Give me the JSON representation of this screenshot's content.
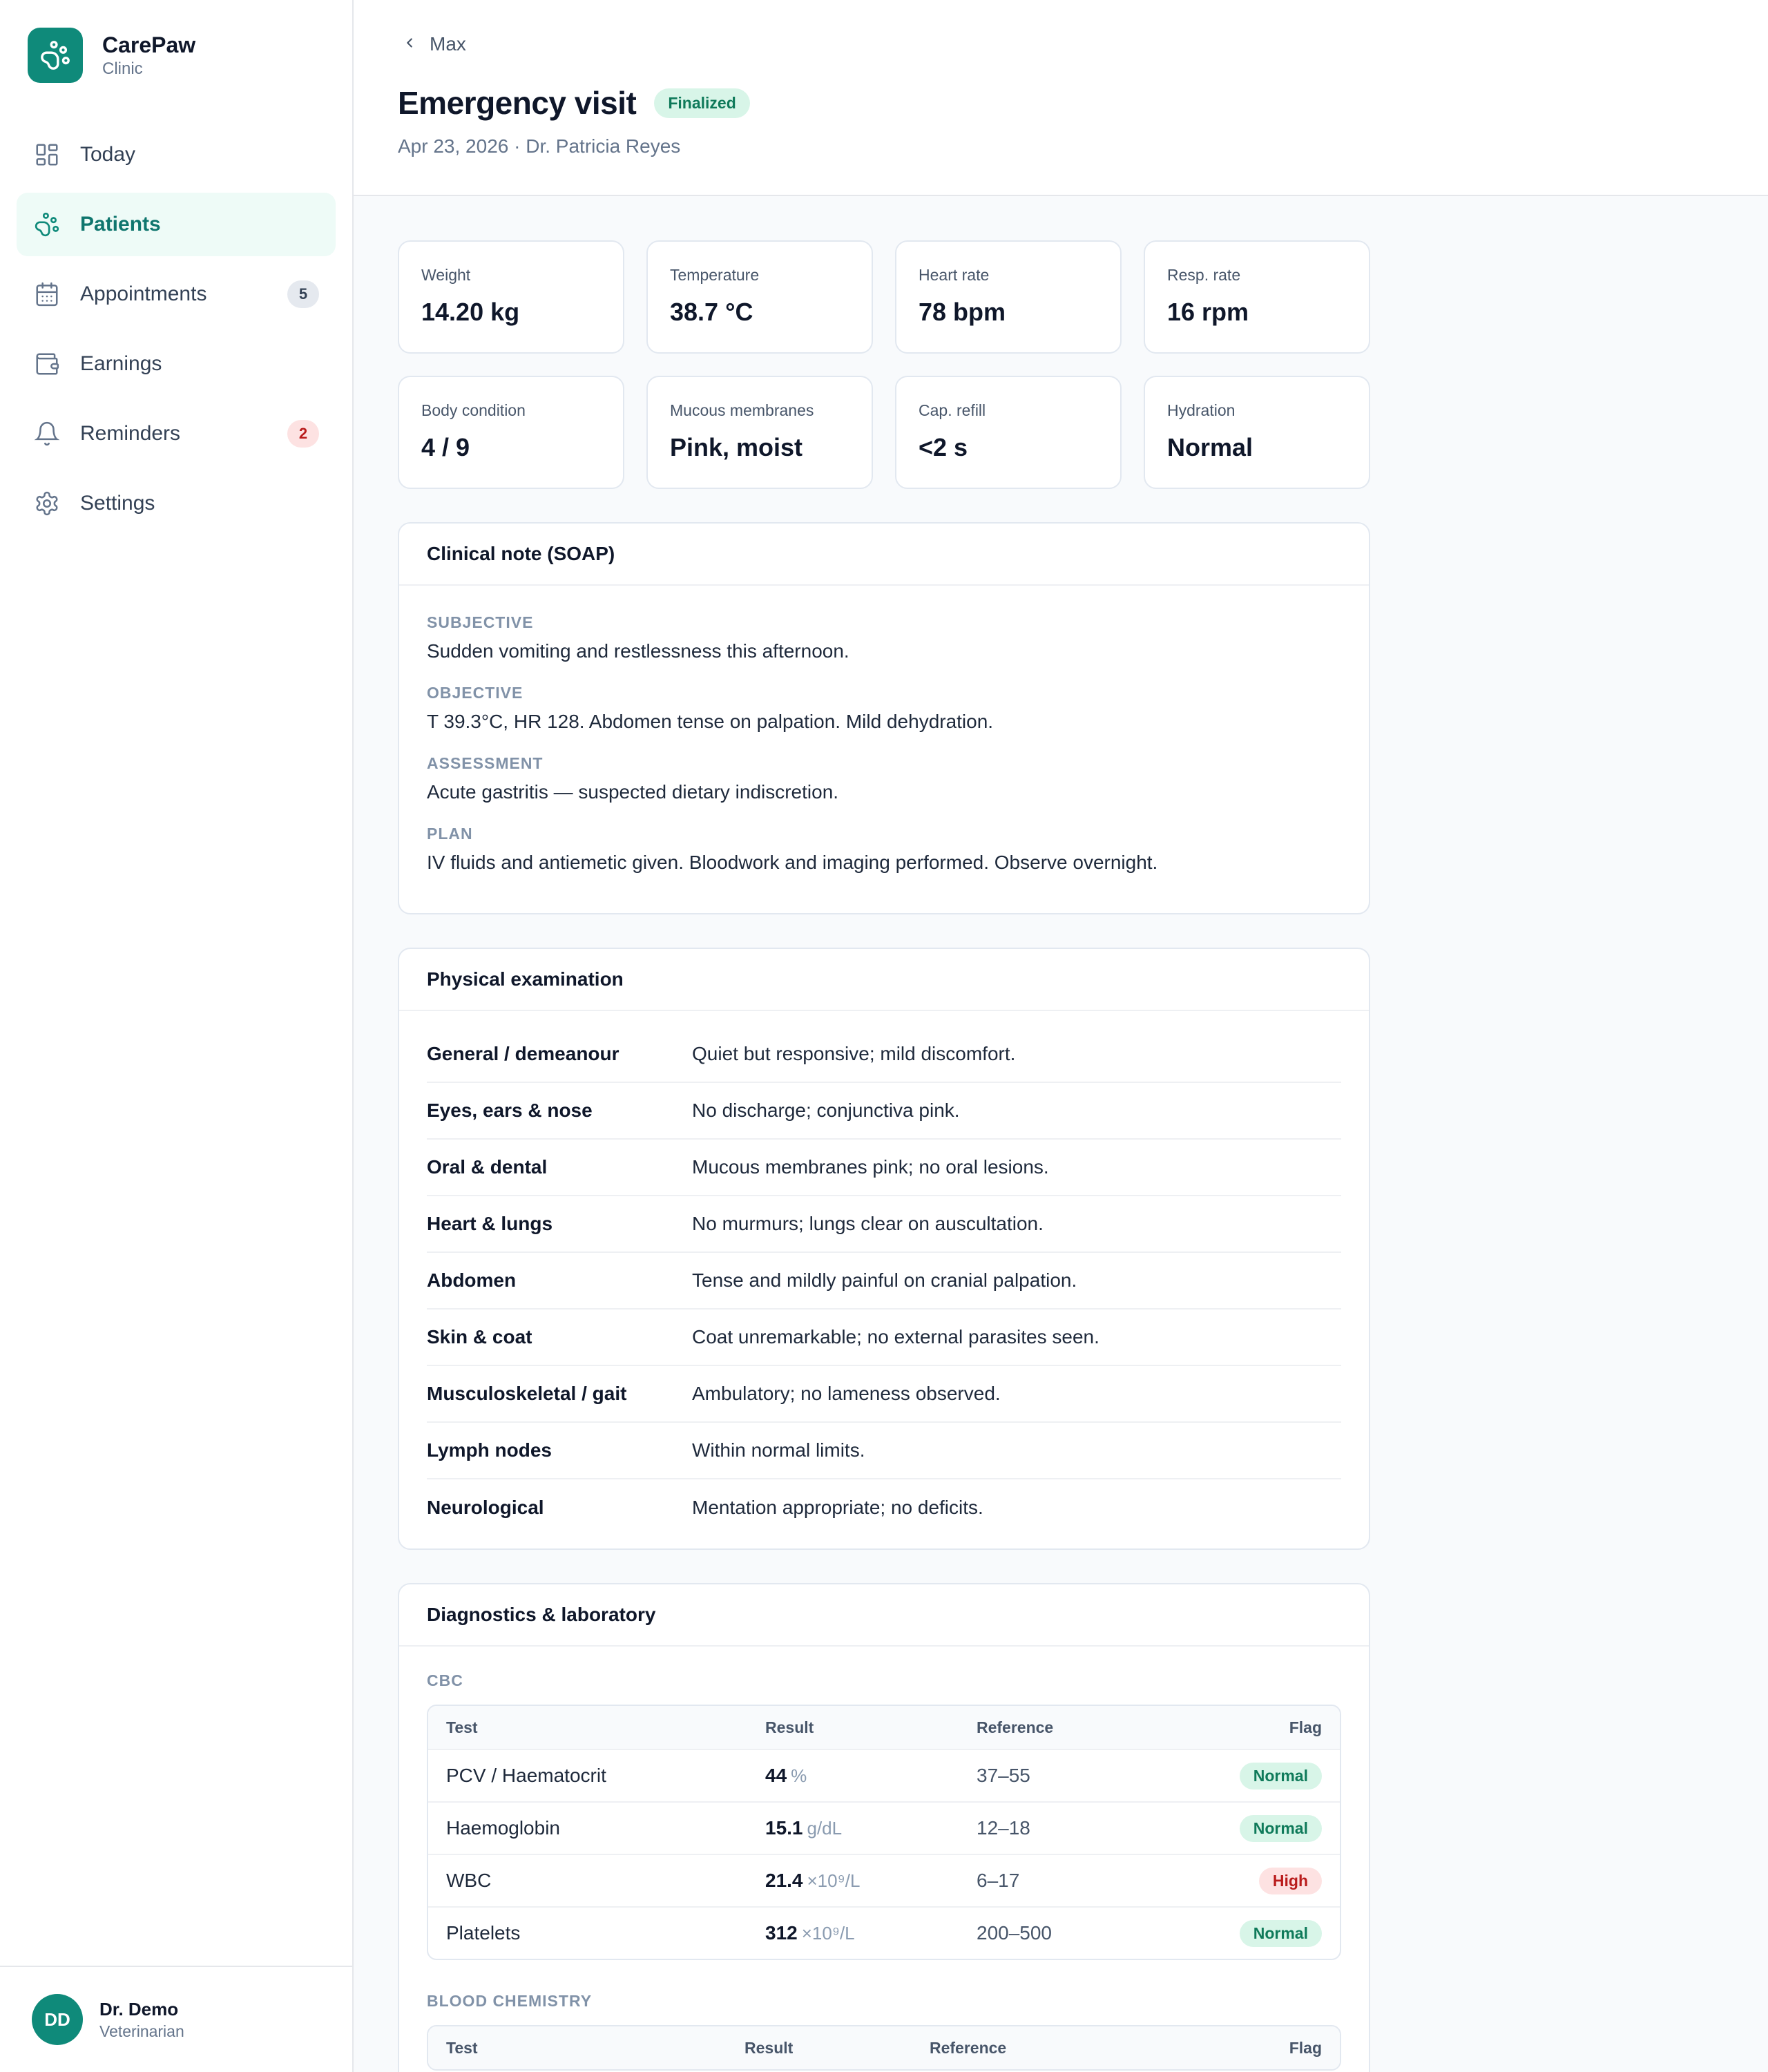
{
  "brand": {
    "name": "CarePaw",
    "subtitle": "Clinic"
  },
  "nav": [
    {
      "label": "Today",
      "icon": "grid-icon"
    },
    {
      "label": "Patients",
      "icon": "paw-icon",
      "active": true
    },
    {
      "label": "Appointments",
      "icon": "calendar-icon",
      "badge": "5"
    },
    {
      "label": "Earnings",
      "icon": "wallet-icon"
    },
    {
      "label": "Reminders",
      "icon": "bell-icon",
      "badge": "2"
    },
    {
      "label": "Settings",
      "icon": "gear-icon"
    }
  ],
  "user": {
    "initials": "DD",
    "name": "Dr. Demo",
    "role": "Veterinarian"
  },
  "header": {
    "back_label": "Max",
    "title": "Emergency visit",
    "status": "Finalized",
    "subtitle": "Apr 23, 2026 · Dr. Patricia Reyes"
  },
  "vitals": [
    {
      "label": "Weight",
      "value": "14.20 kg"
    },
    {
      "label": "Temperature",
      "value": "38.7 °C"
    },
    {
      "label": "Heart rate",
      "value": "78 bpm"
    },
    {
      "label": "Resp. rate",
      "value": "16 rpm"
    },
    {
      "label": "Body condition",
      "value": "4 / 9"
    },
    {
      "label": "Mucous membranes",
      "value": "Pink, moist"
    },
    {
      "label": "Cap. refill",
      "value": "<2 s"
    },
    {
      "label": "Hydration",
      "value": "Normal"
    }
  ],
  "soap": {
    "title": "Clinical note (SOAP)",
    "sections": [
      {
        "label": "SUBJECTIVE",
        "text": "Sudden vomiting and restlessness this afternoon."
      },
      {
        "label": "OBJECTIVE",
        "text": "T 39.3°C, HR 128. Abdomen tense on palpation. Mild dehydration."
      },
      {
        "label": "ASSESSMENT",
        "text": "Acute gastritis — suspected dietary indiscretion."
      },
      {
        "label": "PLAN",
        "text": "IV fluids and antiemetic given. Bloodwork and imaging performed. Observe overnight."
      }
    ]
  },
  "exam": {
    "title": "Physical examination",
    "rows": [
      {
        "key": "General / demeanour",
        "value": "Quiet but responsive; mild discomfort."
      },
      {
        "key": "Eyes, ears & nose",
        "value": "No discharge; conjunctiva pink."
      },
      {
        "key": "Oral & dental",
        "value": "Mucous membranes pink; no oral lesions."
      },
      {
        "key": "Heart & lungs",
        "value": "No murmurs; lungs clear on auscultation."
      },
      {
        "key": "Abdomen",
        "value": "Tense and mildly painful on cranial palpation."
      },
      {
        "key": "Skin & coat",
        "value": "Coat unremarkable; no external parasites seen."
      },
      {
        "key": "Musculoskeletal / gait",
        "value": "Ambulatory; no lameness observed."
      },
      {
        "key": "Lymph nodes",
        "value": "Within normal limits."
      },
      {
        "key": "Neurological",
        "value": "Mentation appropriate; no deficits."
      }
    ]
  },
  "diagnostics": {
    "title": "Diagnostics & laboratory",
    "columns": [
      "Test",
      "Result",
      "Reference",
      "Flag"
    ],
    "cbc": {
      "label": "CBC",
      "rows": [
        {
          "test": "PCV / Haematocrit",
          "result": "44",
          "unit": "%",
          "reference": "37–55",
          "flag": "Normal"
        },
        {
          "test": "Haemoglobin",
          "result": "15.1",
          "unit": "g/dL",
          "reference": "12–18",
          "flag": "Normal"
        },
        {
          "test": "WBC",
          "result": "21.4",
          "unit": "×10⁹/L",
          "reference": "6–17",
          "flag": "High"
        },
        {
          "test": "Platelets",
          "result": "312",
          "unit": "×10⁹/L",
          "reference": "200–500",
          "flag": "Normal"
        }
      ]
    },
    "chemistry": {
      "label": "BLOOD CHEMISTRY"
    }
  },
  "colors": {
    "accent": "#0f8a7a",
    "normal_bg": "#d8f5e8",
    "high_bg": "#fde2e2"
  }
}
